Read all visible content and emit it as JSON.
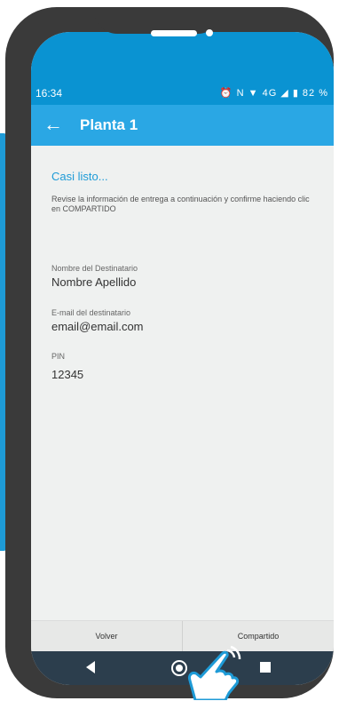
{
  "status_bar": {
    "time": "16:34",
    "icons_text": "⏰ N ▼ 4G ◢ ▮ 82 %"
  },
  "app_bar": {
    "back_icon": "arrow-left-icon",
    "title": "Planta 1"
  },
  "content": {
    "heading": "Casi listo...",
    "description": "Revise la información de entrega a continuación y confirme haciendo clic en COMPARTIDO",
    "fields": [
      {
        "label": "Nombre del Destinatario",
        "value": "Nombre Apellido"
      },
      {
        "label": "E-mail del destinatario",
        "value": "email@email.com"
      },
      {
        "label": "PIN",
        "value": "12345"
      }
    ]
  },
  "bottom_bar": {
    "left_label": "Volver",
    "right_label": "Compartido"
  },
  "colors": {
    "status_bar": "#0a93d2",
    "app_bar": "#2aa7e4",
    "accent": "#1e9bd7",
    "nav_bar": "#2c3e4d",
    "phone_frame": "#3a3a3a"
  }
}
